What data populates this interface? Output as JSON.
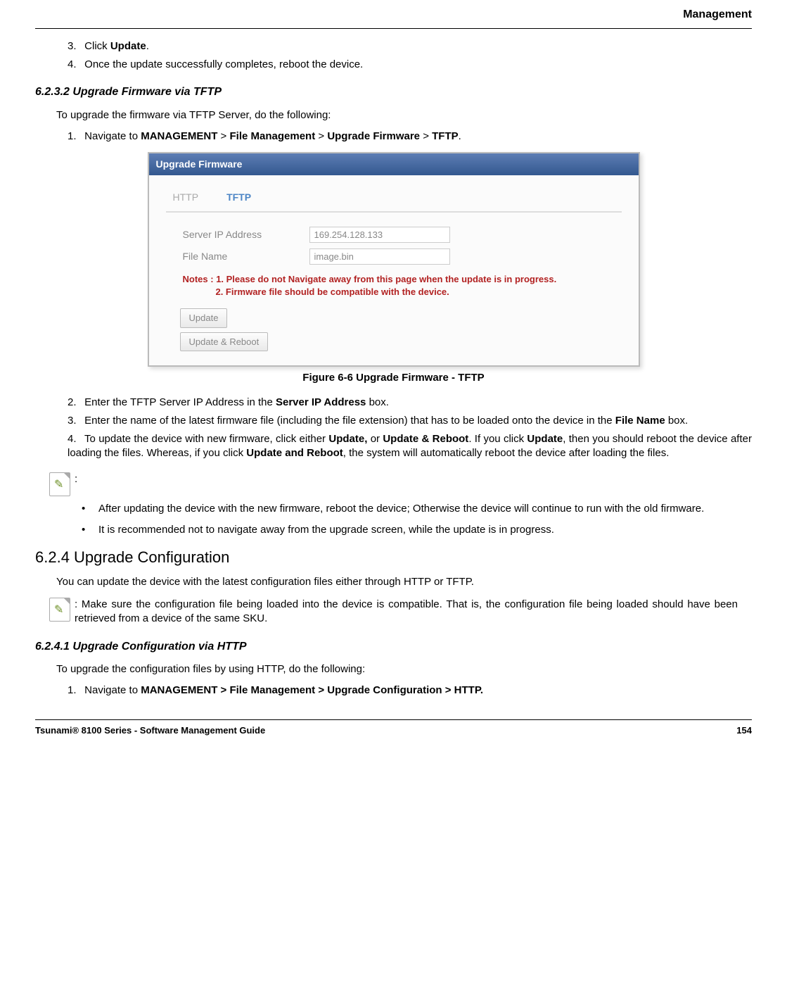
{
  "header": {
    "title": "Management"
  },
  "steps_top": {
    "s3_prefix": "3.",
    "s3_text_a": "Click ",
    "s3_bold": "Update",
    "s3_text_b": ".",
    "s4_prefix": "4.",
    "s4_text": "Once the update successfully completes, reboot the device."
  },
  "section_6232": {
    "heading": "6.2.3.2 Upgrade Firmware via TFTP",
    "intro": "To upgrade the firmware via TFTP Server, do the following:",
    "step1_num": "1.",
    "step1_a": "Navigate to ",
    "step1_b1": "MANAGEMENT",
    "step1_gt1": " > ",
    "step1_b2": "File Management",
    "step1_gt2": " > ",
    "step1_b3": "Upgrade Firmware",
    "step1_gt3": " > ",
    "step1_b4": "TFTP",
    "step1_end": "."
  },
  "screenshot": {
    "title": "Upgrade Firmware",
    "tab_http": "HTTP",
    "tab_tftp": "TFTP",
    "label_ip": "Server IP Address",
    "value_ip": "169.254.128.133",
    "label_file": "File Name",
    "value_file": "image.bin",
    "notes_prefix": "Notes :",
    "note1": "1. Please do not Navigate away from this page when the update is in progress.",
    "note2": "2. Firmware file should be compatible with the device.",
    "btn_update": "Update",
    "btn_update_reboot": "Update & Reboot"
  },
  "figure_caption": "Figure 6-6 Upgrade Firmware - TFTP",
  "steps_after": {
    "s2_num": "2.",
    "s2_a": "Enter the TFTP Server IP Address in the ",
    "s2_b": "Server IP Address",
    "s2_c": " box.",
    "s3_num": "3.",
    "s3_a": "Enter the name of the latest firmware file (including the file extension) that has to be loaded onto the device in the ",
    "s3_b": "File Name",
    "s3_c": " box.",
    "s4_num": "4.",
    "s4_a": "To update the device with new firmware, click either ",
    "s4_b1": "Update,",
    "s4_mid1": " or ",
    "s4_b2": "Update & Reboot",
    "s4_mid2": ". If you click ",
    "s4_b3": "Update",
    "s4_mid3": ", then you should reboot the device after loading the files. Whereas, if you click ",
    "s4_b4": "Update and Reboot",
    "s4_end": ", the system will automatically reboot the device after loading the files."
  },
  "note_block": {
    "colon": ":",
    "bullet1": "After updating the device with the new firmware, reboot the device; Otherwise the device will continue to run with the old firmware.",
    "bullet2": "It is recommended not to navigate away from the upgrade screen, while the update is in progress."
  },
  "section_624": {
    "heading": "6.2.4 Upgrade Configuration",
    "intro": "You can update the device with the latest configuration files either through HTTP or TFTP.",
    "note": ": Make sure the configuration file being loaded into the device is compatible. That is, the configuration file being loaded should have been retrieved from a device of the same SKU."
  },
  "section_6241": {
    "heading": "6.2.4.1 Upgrade Configuration via HTTP",
    "intro": "To upgrade the configuration files by using HTTP, do the following:",
    "step1_num": "1.",
    "step1_a": "Navigate to ",
    "step1_b": "MANAGEMENT > File Management > Upgrade Configuration > HTTP."
  },
  "footer": {
    "left": "Tsunami® 8100 Series - Software Management Guide",
    "right": "154"
  }
}
